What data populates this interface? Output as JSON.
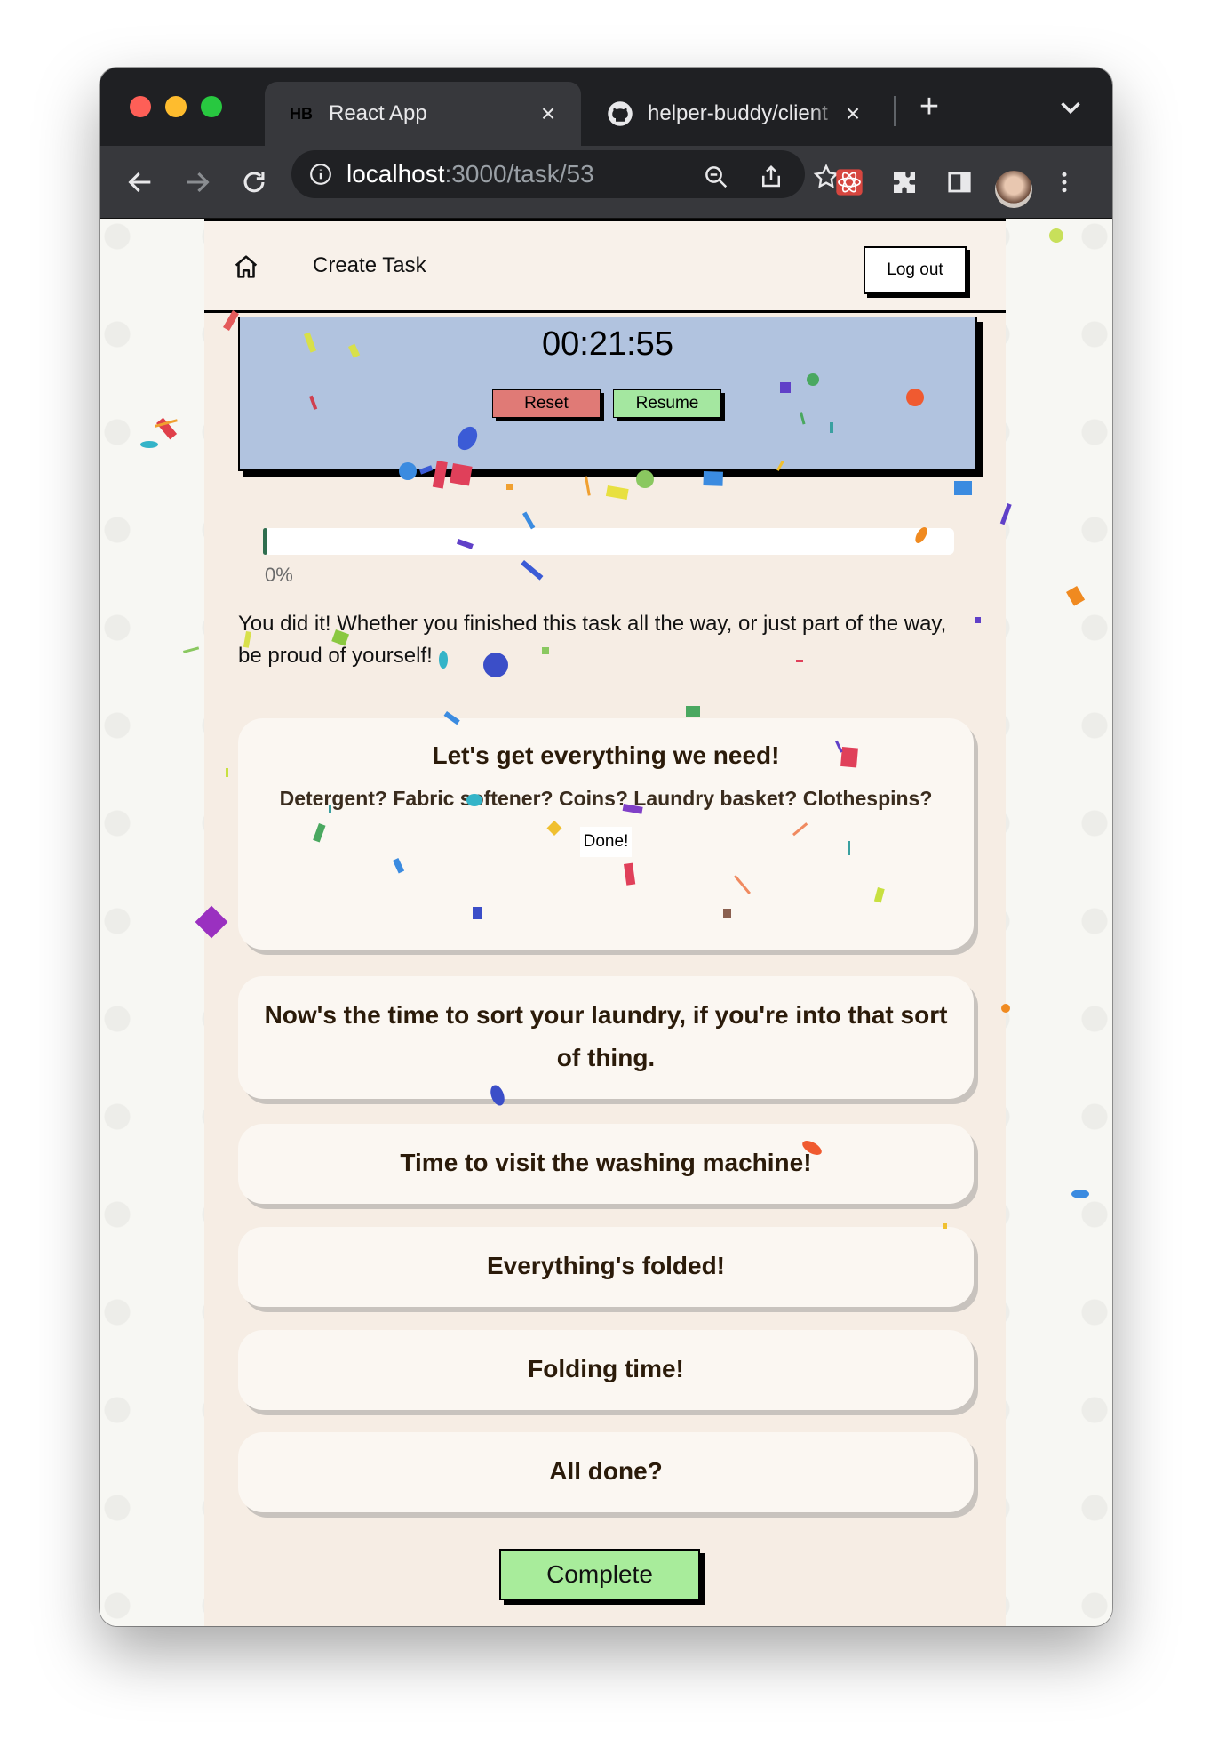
{
  "browser": {
    "tabs": [
      {
        "favicon": "HB",
        "title": "React App"
      },
      {
        "favicon": "github-icon",
        "title": "helper-buddy/client"
      }
    ],
    "url_host": "localhost",
    "url_path": ":3000/task/53"
  },
  "nav": {
    "create_task": "Create Task",
    "logout": "Log out"
  },
  "timer": {
    "time": "00:21:55",
    "reset_label": "Reset",
    "resume_label": "Resume"
  },
  "progress": {
    "value": 0,
    "label": "0%"
  },
  "message": "You did it! Whether you finished this task all the way, or just part of the way, be proud of yourself!",
  "steps": [
    {
      "title": "Let's get everything we need!",
      "description": "Detergent? Fabric softener? Coins? Laundry basket? Clothespins?",
      "done_label": "Done!"
    },
    {
      "title": "Now's the time to sort your laundry, if you're into that sort of thing."
    },
    {
      "title": "Time to visit the washing machine!"
    },
    {
      "title": "Everything's folded!"
    },
    {
      "title": "Folding time!"
    },
    {
      "title": "All done?"
    }
  ],
  "complete_label": "Complete",
  "colors": {
    "page_bg": "#f6ede4",
    "timer_bg": "#b1c3df",
    "reset": "#e07a76",
    "resume": "#a4e7a0",
    "complete": "#a8ec9b",
    "progress": "#2f6e4f"
  }
}
